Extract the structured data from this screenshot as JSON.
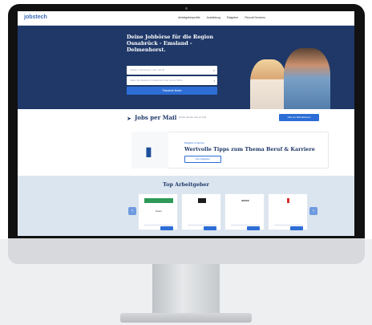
{
  "site": {
    "logo_main": "jobs",
    "logo_accent": "tech"
  },
  "nav": [
    "Arbeitgeberprofile",
    "Ausbildung",
    "Ratgeber",
    "Recruit Services"
  ],
  "hero": {
    "title": "Deine Jobbörse für die Region Osnabrück - Emsland - Delmenhorst.",
    "field1_placeholder": "Jobtitel, Stichworten oder Job ID",
    "field2_placeholder": "Stadt, Bundesland, Postleitzahl oder Home Office",
    "button": "Passende finden"
  },
  "mail": {
    "title": "Jobs per Mail",
    "text": "Erhalte aktuelle Jobs per Mail",
    "button": "Jobs per Mail aktivieren"
  },
  "tips": {
    "kicker": "Ratgeber & Karriere",
    "title": "Wertvolle Tipps zum Thema Beruf & Karriere",
    "button": "Zum Ratgeber"
  },
  "employers": {
    "title": "Top Arbeitgeber",
    "cards": [
      {
        "logo": "",
        "name": "Enders"
      },
      {
        "logo": "",
        "name": ""
      },
      {
        "logo": "BOKER",
        "name": ""
      },
      {
        "logo": "",
        "name": ""
      }
    ]
  },
  "colors": {
    "brand_dark": "#1f3868",
    "accent_blue": "#2d6ed6",
    "employer_bg": "#dbe5ef"
  }
}
